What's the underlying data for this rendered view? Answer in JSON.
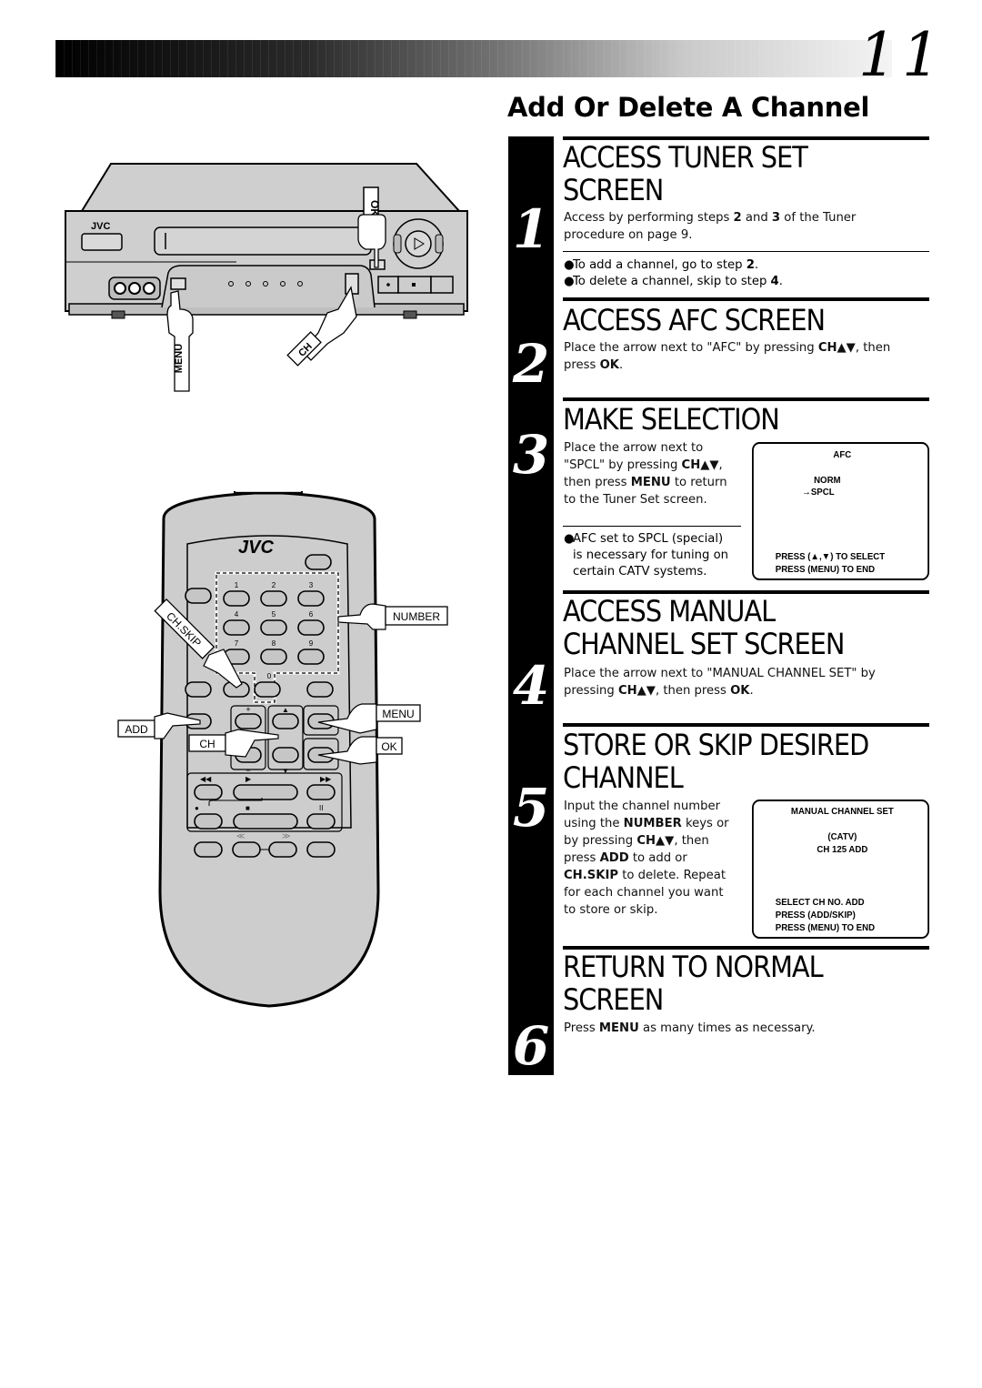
{
  "page": {
    "page_number": "11",
    "section_title": "Add Or Delete A Channel"
  },
  "steps": [
    {
      "number": "1",
      "heading_lines": [
        "ACCESS TUNER SET",
        "SCREEN"
      ],
      "body": {
        "t1": "Access by performing steps ",
        "b1": "2",
        "t2": " and ",
        "b2": "3",
        "t3": " of the Tuner",
        "line2": "procedure on page 9."
      },
      "bullets": [
        {
          "text": "To add a channel, go to step ",
          "bold": "2",
          "end": "."
        },
        {
          "text": "To delete a channel, skip to step ",
          "bold": "4",
          "end": "."
        }
      ]
    },
    {
      "number": "2",
      "heading_lines": [
        "ACCESS AFC SCREEN"
      ],
      "body": {
        "t1": "Place the arrow next to \"AFC\" by pressing ",
        "b1": "CH▲▼",
        "t2": ", then",
        "t3": "press ",
        "b2": "OK",
        "t4": "."
      }
    },
    {
      "number": "3",
      "heading_lines": [
        "MAKE SELECTION"
      ],
      "body": {
        "l1": "Place the arrow next to",
        "l2a": "\"SPCL\" by pressing ",
        "l2b": "CH▲▼",
        "l2c": ",",
        "l3a": "then press ",
        "l3b": "MENU",
        "l3c": " to return",
        "l4": "to the Tuner Set screen."
      },
      "note_lines": [
        "AFC set to SPCL (special)",
        "is necessary for tuning on",
        "certain CATV systems."
      ],
      "osd": {
        "title": "AFC",
        "options": [
          "NORM",
          "SPCL"
        ],
        "selected_arrow": "→",
        "footer": [
          "PRESS (▲,▼) TO SELECT",
          "PRESS (MENU) TO END"
        ]
      }
    },
    {
      "number": "4",
      "heading_lines": [
        "ACCESS MANUAL",
        "CHANNEL SET SCREEN"
      ],
      "body": {
        "t1": "Place the arrow next to \"MANUAL CHANNEL SET\" by",
        "t2": "pressing ",
        "b1": "CH▲▼",
        "t3": ", then press ",
        "b2": "OK",
        "t4": "."
      }
    },
    {
      "number": "5",
      "heading_lines": [
        "STORE OR SKIP DESIRED",
        "CHANNEL"
      ],
      "body": {
        "l1": "Input the channel number",
        "l2a": "using the ",
        "l2b": "NUMBER",
        "l2c": " keys or",
        "l3a": "by pressing ",
        "l3b": "CH▲▼",
        "l3c": ", then",
        "l4a": "press ",
        "l4b": "ADD",
        "l4c": " to add or",
        "l5a": "CH.SKIP",
        "l5b": " to delete. Repeat",
        "l6": "for each channel you want",
        "l7": "to store or skip."
      },
      "osd": {
        "title": "MANUAL CHANNEL SET",
        "mode": "(CATV)",
        "channel": "CH 125 ADD",
        "footer": [
          "SELECT CH NO. ADD",
          "PRESS (ADD/SKIP)",
          "PRESS (MENU) TO END"
        ]
      }
    },
    {
      "number": "6",
      "heading_lines": [
        "RETURN TO NORMAL",
        "SCREEN"
      ],
      "body": {
        "t1": "Press ",
        "b1": "MENU",
        "t2": " as many times as necessary."
      }
    }
  ],
  "vcr": {
    "brand": "JVC",
    "callouts": {
      "ok": "OK",
      "menu": "MENU",
      "ch": "CH"
    }
  },
  "remote": {
    "brand": "JVC",
    "number_keys": [
      "1",
      "2",
      "3",
      "4",
      "5",
      "6",
      "7",
      "8",
      "9",
      "0"
    ],
    "key_symbols": {
      "plus": "+",
      "minus": "−",
      "up": "▲",
      "down": "▼",
      "rew": "◀◀",
      "play": "▶",
      "ff": "▶▶",
      "rec": "●",
      "stop": "■",
      "pause": "II",
      "skip_back": "≪",
      "skip_fwd": "≫"
    },
    "callouts": {
      "number": "NUMBER",
      "ch_skip": "CH.SKIP",
      "add": "ADD",
      "ch": "CH",
      "menu": "MENU",
      "ok": "OK"
    }
  }
}
